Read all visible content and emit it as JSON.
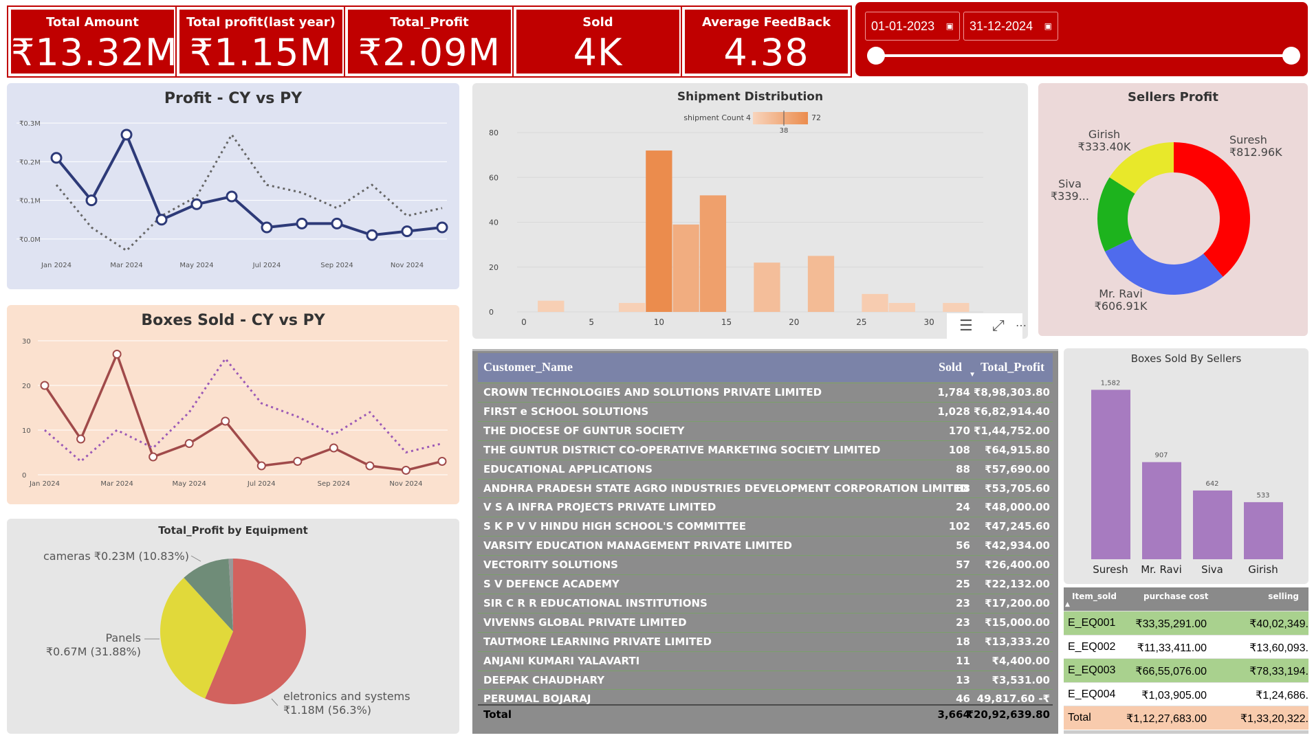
{
  "kpis": [
    {
      "label": "Total Amount",
      "value": "₹13.32M"
    },
    {
      "label": "Total profit(last year)",
      "value": "₹1.15M"
    },
    {
      "label": "Total_Profit",
      "value": "₹2.09M"
    },
    {
      "label": "Sold",
      "value": "4K"
    },
    {
      "label": "Average FeedBack",
      "value": "4.38"
    }
  ],
  "date_slicer": {
    "start": "01-01-2023",
    "end": "31-12-2024",
    "range_fraction": [
      0,
      1
    ],
    "calendar_icon": "calendar-icon"
  },
  "colors": {
    "brand_red": "#c00000",
    "profit_cy": "#2d3a78",
    "boxes_cy": "#a04a4a",
    "boxes_py": "#9b59b6",
    "hist": "#eb8c4d",
    "seller_bar": "#a77bc0"
  },
  "chart_data": [
    {
      "type": "line",
      "title": "Profit - CY vs PY",
      "y_tick_labels": [
        "₹0.0M",
        "₹0.1M",
        "₹0.2M",
        "₹0.3M"
      ],
      "x_tick_labels": [
        "Jan 2024",
        "Mar 2024",
        "May 2024",
        "Jul 2024",
        "Sep 2024",
        "Nov 2024"
      ],
      "x": [
        "Jan 2024",
        "Feb 2024",
        "Mar 2024",
        "Apr 2024",
        "May 2024",
        "Jun 2024",
        "Jul 2024",
        "Aug 2024",
        "Sep 2024",
        "Oct 2024",
        "Nov 2024",
        "Dec 2024"
      ],
      "ylim": [
        -0.05,
        0.35
      ],
      "series": [
        {
          "values": [
            0.21,
            0.1,
            0.27,
            0.05,
            0.09,
            0.11,
            0.03,
            0.04,
            0.04,
            0.01,
            0.02,
            0.03
          ],
          "style": "solid"
        },
        {
          "values": [
            0.14,
            0.03,
            -0.03,
            0.06,
            0.11,
            0.27,
            0.14,
            0.12,
            0.08,
            0.14,
            0.06,
            0.08
          ],
          "style": "dotted"
        }
      ]
    },
    {
      "type": "line",
      "title": "Boxes Sold - CY vs PY",
      "y_tick_labels": [
        "0",
        "10",
        "20",
        "30"
      ],
      "x_tick_labels": [
        "Jan 2024",
        "Mar 2024",
        "May 2024",
        "Jul 2024",
        "Sep 2024",
        "Nov 2024"
      ],
      "x": [
        "Jan 2024",
        "Feb 2024",
        "Mar 2024",
        "Apr 2024",
        "May 2024",
        "Jun 2024",
        "Jul 2024",
        "Aug 2024",
        "Sep 2024",
        "Oct 2024",
        "Nov 2024",
        "Dec 2024"
      ],
      "ylim": [
        0,
        30
      ],
      "series": [
        {
          "values": [
            20,
            8,
            27,
            4,
            7,
            12,
            2,
            3,
            6,
            2,
            1,
            3
          ],
          "style": "solid"
        },
        {
          "values": [
            10,
            3,
            10,
            6,
            14,
            26,
            16,
            13,
            9,
            14,
            5,
            7
          ],
          "style": "dotted"
        }
      ]
    },
    {
      "type": "bar",
      "title": "Shipment Distribution",
      "legend": {
        "label": "shipment Count",
        "min": "4",
        "mid": "38",
        "max": "72"
      },
      "x_ticks": [
        0,
        5,
        10,
        15,
        20,
        25,
        30
      ],
      "y_ticks": [
        0,
        20,
        40,
        60,
        80
      ],
      "xlim": [
        0,
        33
      ],
      "ylim": [
        0,
        80
      ],
      "bins": [
        {
          "x0": 1,
          "x1": 3,
          "value": 5
        },
        {
          "x0": 3,
          "x1": 5,
          "value": 0
        },
        {
          "x0": 5,
          "x1": 7,
          "value": 0
        },
        {
          "x0": 7,
          "x1": 9,
          "value": 4
        },
        {
          "x0": 9,
          "x1": 11,
          "value": 72
        },
        {
          "x0": 11,
          "x1": 13,
          "value": 39
        },
        {
          "x0": 13,
          "x1": 15,
          "value": 52
        },
        {
          "x0": 15,
          "x1": 17,
          "value": 0
        },
        {
          "x0": 17,
          "x1": 19,
          "value": 22
        },
        {
          "x0": 19,
          "x1": 21,
          "value": 0
        },
        {
          "x0": 21,
          "x1": 23,
          "value": 25
        },
        {
          "x0": 23,
          "x1": 25,
          "value": 0
        },
        {
          "x0": 25,
          "x1": 27,
          "value": 8
        },
        {
          "x0": 27,
          "x1": 29,
          "value": 4
        },
        {
          "x0": 29,
          "x1": 31,
          "value": 0
        },
        {
          "x0": 31,
          "x1": 33,
          "value": 4
        }
      ]
    },
    {
      "type": "pie",
      "title": "Sellers Profit",
      "donut": true,
      "slices": [
        {
          "name": "Suresh",
          "value_label": "₹812.96K",
          "value": 812.96,
          "color": "#ff0000"
        },
        {
          "name": "Mr. Ravi",
          "value_label": "₹606.91K",
          "value": 606.91,
          "color": "#4f6bed"
        },
        {
          "name": "Siva",
          "value_label": "₹339...",
          "value": 339.0,
          "color": "#1db31d"
        },
        {
          "name": "Girish",
          "value_label": "₹333.40K",
          "value": 333.4,
          "color": "#e8e82a"
        }
      ]
    },
    {
      "type": "pie",
      "title": "Total_Profit by Equipment",
      "slices": [
        {
          "name": "eletronics and systems",
          "value_label": "₹1.18M (56.3%)",
          "value": 56.3,
          "color": "#d2625e"
        },
        {
          "name": "Panels",
          "value_label": "₹0.67M (31.88%)",
          "value": 31.88,
          "color": "#e1d93a"
        },
        {
          "name": "cameras",
          "value_label": "₹0.23M (10.83%)",
          "value": 10.83,
          "color": "#6f8c78"
        },
        {
          "name": "",
          "value_label": "",
          "value": 0.99,
          "color": "#999999"
        }
      ]
    },
    {
      "type": "bar",
      "title": "Boxes Sold By Sellers",
      "categories": [
        "Suresh",
        "Mr. Ravi",
        "Siva",
        "Girish"
      ],
      "values": [
        1582,
        907,
        642,
        533
      ],
      "value_labels": [
        "1,582",
        "907",
        "642",
        "533"
      ],
      "ylim": [
        0,
        1700
      ]
    },
    {
      "type": "table",
      "title": "",
      "columns": [
        "Customer_Name",
        "Sold",
        "Total_Profit"
      ],
      "sort_indicator": "Total_Profit descending",
      "rows": [
        {
          "name": "CROWN TECHNOLOGIES AND SOLUTIONS PRIVATE LIMITED",
          "sold": "1,784",
          "profit": "₹8,98,303.80"
        },
        {
          "name": "FIRST e SCHOOL SOLUTIONS",
          "sold": "1,028",
          "profit": "₹6,82,914.40"
        },
        {
          "name": "THE DIOCESE OF GUNTUR SOCIETY",
          "sold": "170",
          "profit": "₹1,44,752.00"
        },
        {
          "name": "THE GUNTUR DISTRICT CO-OPERATIVE MARKETING SOCIETY LIMITED",
          "sold": "108",
          "profit": "₹64,915.80"
        },
        {
          "name": "EDUCATIONAL APPLICATIONS",
          "sold": "88",
          "profit": "₹57,690.00"
        },
        {
          "name": "ANDHRA PRADESH STATE AGRO INDUSTRIES DEVELOPMENT CORPORATION LIMITED",
          "sold": "88",
          "profit": "₹53,705.60"
        },
        {
          "name": "V S A INFRA PROJECTS PRIVATE LIMITED",
          "sold": "24",
          "profit": "₹48,000.00"
        },
        {
          "name": "S K P V V HINDU HIGH SCHOOL'S COMMITTEE",
          "sold": "102",
          "profit": "₹47,245.60"
        },
        {
          "name": "VARSITY EDUCATION MANAGEMENT PRIVATE LIMITED",
          "sold": "56",
          "profit": "₹42,934.00"
        },
        {
          "name": "VECTORITY SOLUTIONS",
          "sold": "57",
          "profit": "₹26,400.00"
        },
        {
          "name": "S V DEFENCE ACADEMY",
          "sold": "25",
          "profit": "₹22,132.00"
        },
        {
          "name": "SIR C R R EDUCATIONAL INSTITUTIONS",
          "sold": "23",
          "profit": "₹17,200.00"
        },
        {
          "name": "VIVENNS GLOBAL PRIVATE LIMITED",
          "sold": "23",
          "profit": "₹15,000.00"
        },
        {
          "name": "TAUTMORE LEARNING PRIVATE LIMITED",
          "sold": "18",
          "profit": "₹13,333.20"
        },
        {
          "name": "ANJANI KUMARI YALAVARTI",
          "sold": "11",
          "profit": "₹4,400.00"
        },
        {
          "name": "DEEPAK CHAUDHARY",
          "sold": "13",
          "profit": "₹3,531.00"
        },
        {
          "name": "PERUMAL BOJARAJ",
          "sold": "46",
          "profit": "49,817.60 -₹"
        }
      ],
      "total": {
        "label": "Total",
        "sold": "3,664",
        "profit": "₹20,92,639.80"
      }
    },
    {
      "type": "table",
      "title": "",
      "columns": [
        "Item_sold",
        "purchase cost",
        "selling"
      ],
      "rows": [
        {
          "item": "E_EQ001",
          "purchase": "₹33,35,291.00",
          "selling": "₹40,02,349.",
          "bg": "#a9d18e"
        },
        {
          "item": "E_EQ002",
          "purchase": "₹11,33,411.00",
          "selling": "₹13,60,093.",
          "bg": "#ffffff"
        },
        {
          "item": "E_EQ003",
          "purchase": "₹66,55,076.00",
          "selling": "₹78,33,194.",
          "bg": "#a9d18e"
        },
        {
          "item": "E_EQ004",
          "purchase": "₹1,03,905.00",
          "selling": "₹1,24,686.",
          "bg": "#ffffff"
        }
      ],
      "total": {
        "label": "Total",
        "purchase": "₹1,12,27,683.00",
        "selling": "₹1,33,20,322.",
        "bg": "#f8cbad"
      }
    }
  ]
}
